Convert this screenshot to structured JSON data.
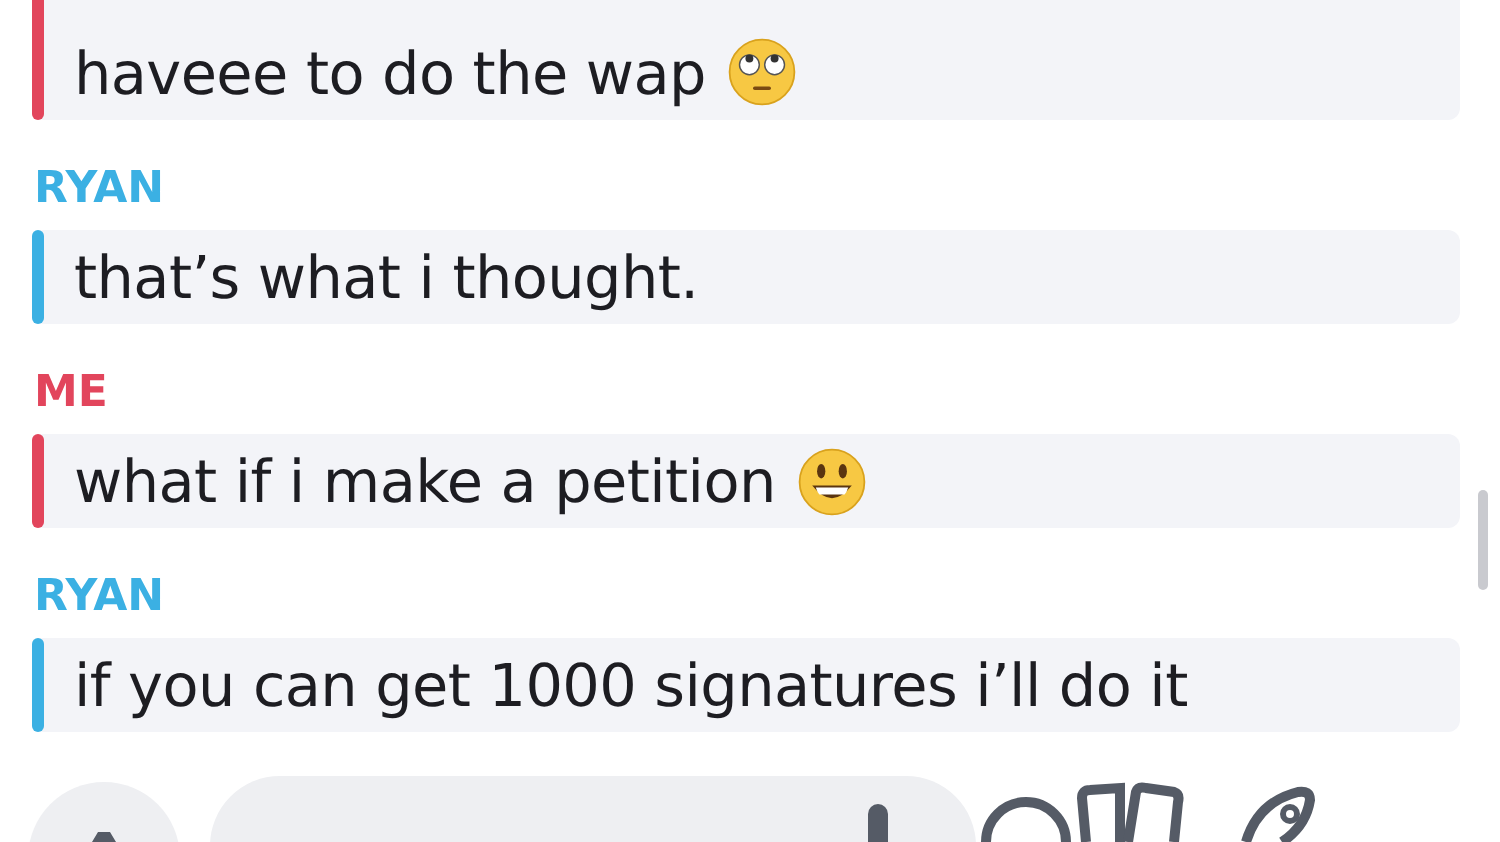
{
  "messages": [
    {
      "color": "#e2455c",
      "text": "haveee to do the wap",
      "kind": "eyeroll"
    },
    {
      "sender": "RYAN",
      "color": "#3bb0e3",
      "text": "that’s what i thought.",
      "kind": "plain"
    },
    {
      "sender": "ME",
      "color": "#e2455c",
      "text": "what if i make a petition",
      "kind": "grin"
    },
    {
      "sender": "RYAN",
      "color": "#3bb0e3",
      "text": "if you can get 1000 signatures i’ll do it",
      "kind": "plain"
    }
  ]
}
